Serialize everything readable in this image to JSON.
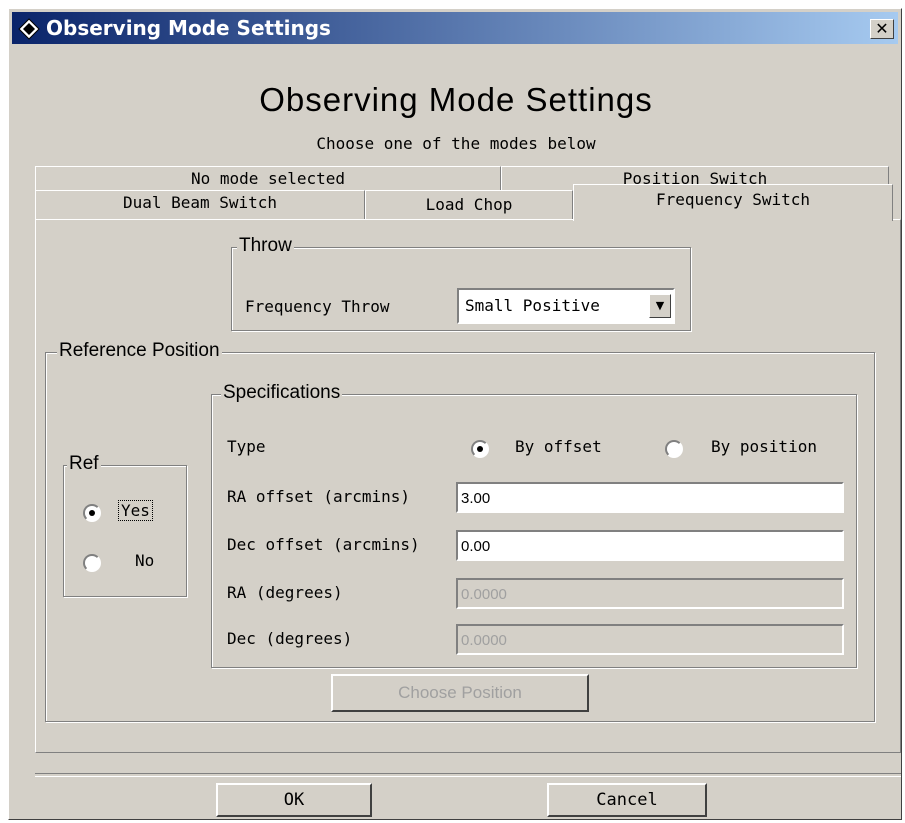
{
  "window": {
    "title": "Observing Mode Settings",
    "close_glyph": "✕"
  },
  "header": {
    "title": "Observing Mode Settings",
    "subtitle": "Choose one of the modes below"
  },
  "tabs": {
    "row1": [
      "No mode selected",
      "Position Switch"
    ],
    "row2": [
      "Dual Beam Switch",
      "Load Chop",
      "Frequency Switch"
    ],
    "selected": "Frequency Switch"
  },
  "throw_group": {
    "legend": "Throw",
    "label": "Frequency Throw",
    "value": "Small Positive"
  },
  "reference": {
    "legend": "Reference Position",
    "ref_group": {
      "legend": "Ref",
      "options": [
        "Yes",
        "No"
      ],
      "selected": "Yes"
    },
    "specs": {
      "legend": "Specifications",
      "type_label": "Type",
      "type_options": [
        "By offset",
        "By position"
      ],
      "type_selected": "By offset",
      "ra_offset_label": "RA offset (arcmins)",
      "ra_offset_value": "3.00",
      "dec_offset_label": "Dec offset (arcmins)",
      "dec_offset_value": "0.00",
      "ra_label": "RA (degrees)",
      "ra_value": "0.0000",
      "dec_label": "Dec (degrees)",
      "dec_value": "0.0000"
    },
    "choose_label": "Choose Position"
  },
  "footer": {
    "ok_label": "OK",
    "cancel_label": "Cancel"
  },
  "icons": [
    "app-icon",
    "close-icon",
    "dropdown-arrow-icon"
  ],
  "colors": {
    "titlebar_start": "#0a246a",
    "titlebar_end": "#a6caf0",
    "face": "#d4d0c8"
  }
}
